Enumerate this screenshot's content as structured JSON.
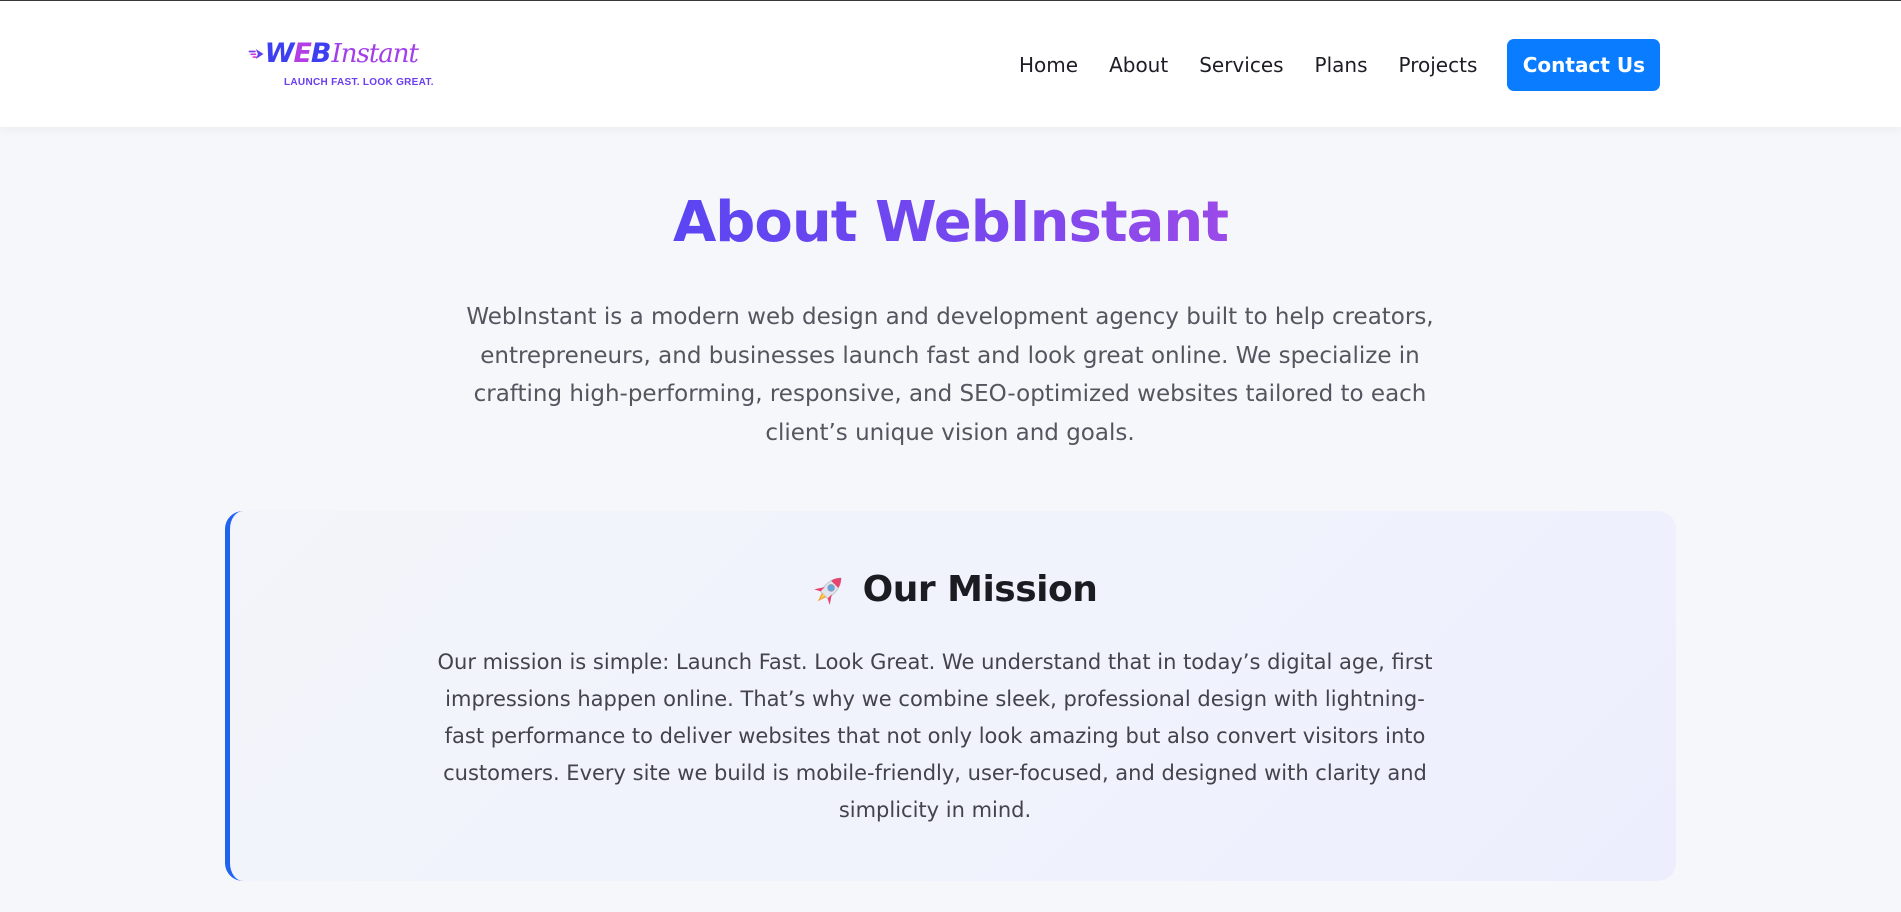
{
  "header": {
    "logo": {
      "word_web_1": "W",
      "word_web_2": "E",
      "word_web_3": "B",
      "word_instant": "Instant",
      "tagline": "LAUNCH FAST. LOOK GREAT."
    },
    "nav": {
      "items": [
        {
          "label": "Home"
        },
        {
          "label": "About"
        },
        {
          "label": "Services"
        },
        {
          "label": "Plans"
        },
        {
          "label": "Projects"
        }
      ],
      "cta_label": "Contact Us"
    }
  },
  "about": {
    "title": "About WebInstant",
    "intro": "WebInstant is a modern web design and development agency built to help creators, entrepreneurs, and businesses launch fast and look great online. We specialize in crafting high-performing, responsive, and SEO-optimized websites tailored to each client’s unique vision and goals."
  },
  "mission": {
    "icon": "rocket-icon",
    "title": "Our Mission",
    "text": "Our mission is simple: Launch Fast. Look Great. We understand that in today’s digital age, first impressions happen online. That’s why we combine sleek, professional design with lightning-fast performance to deliver websites that not only look amazing but also convert visitors into customers. Every site we build is mobile-friendly, user-focused, and designed with clarity and simplicity in mind."
  },
  "colors": {
    "accent": "#0a7cff",
    "title_gradient_start": "#5b45f2",
    "title_gradient_end": "#9b4ae8",
    "card_border": "#1f63ee",
    "background": "#f6f7fa"
  }
}
